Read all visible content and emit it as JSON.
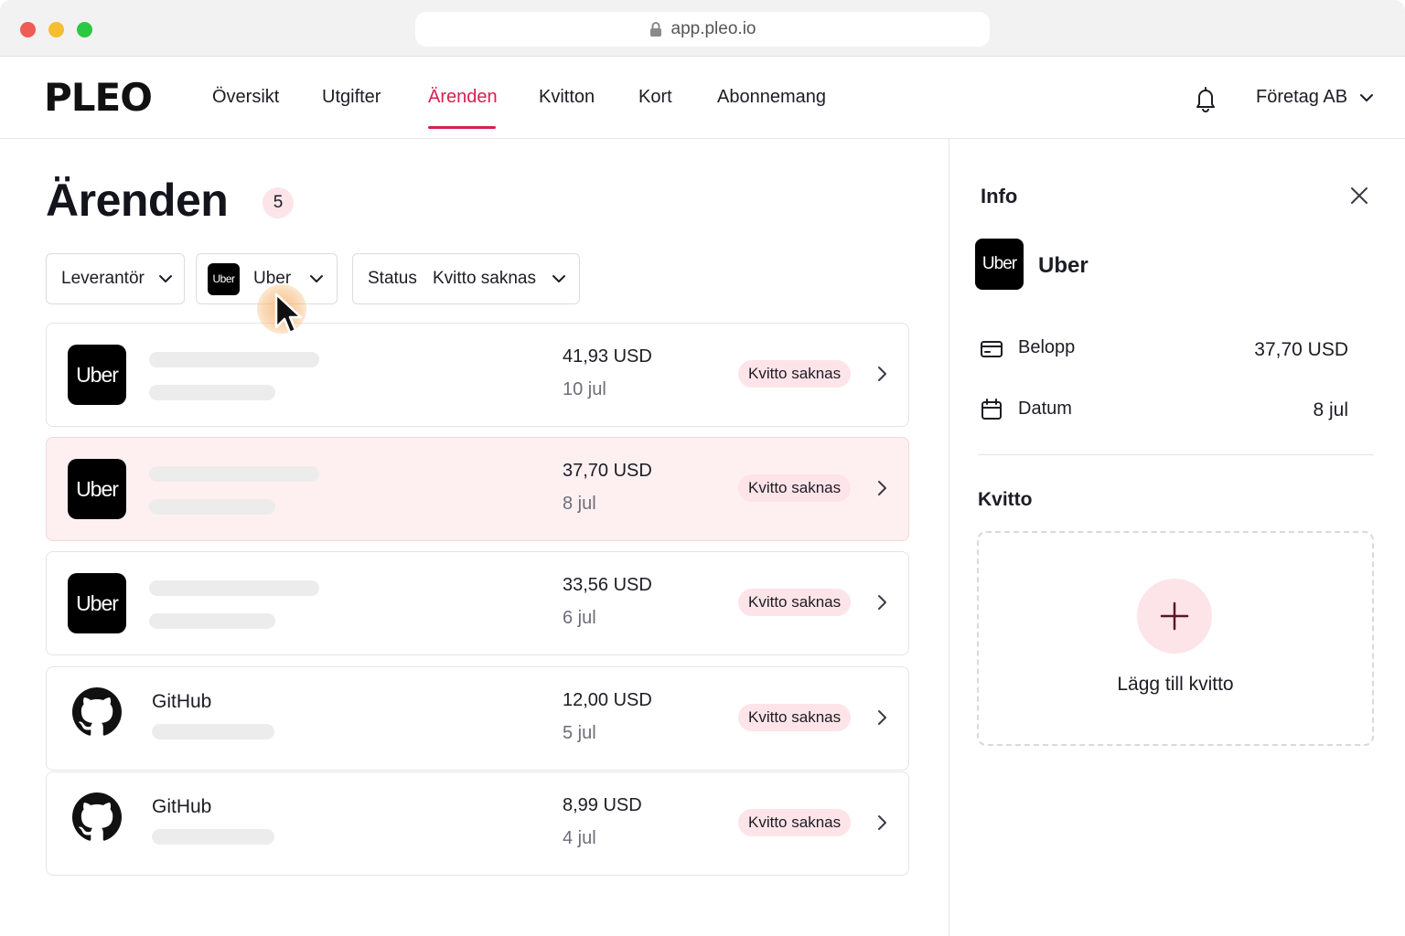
{
  "browser": {
    "url": "app.pleo.io"
  },
  "brand": {
    "logo": "PLEO",
    "accent": "#d6204f",
    "badge_bg": "#fde4e8"
  },
  "nav": {
    "items": [
      {
        "label": "Översikt"
      },
      {
        "label": "Utgifter"
      },
      {
        "label": "Ärenden"
      },
      {
        "label": "Kvitton"
      },
      {
        "label": "Kort"
      },
      {
        "label": "Abonnemang"
      }
    ],
    "active": "Ärenden",
    "company": "Företag AB"
  },
  "page": {
    "title": "Ärenden",
    "count": "5"
  },
  "filters": {
    "supplier_label": "Leverantör",
    "vendor_label": "Uber",
    "vendor_logo": "Uber",
    "status_label": "Status",
    "status_value": "Kvitto saknas"
  },
  "rows": [
    {
      "logo": "Uber",
      "vendor": "",
      "amount": "41,93 USD",
      "date": "10 jul",
      "status": "Kvitto saknas",
      "selected": false
    },
    {
      "logo": "Uber",
      "vendor": "",
      "amount": "37,70 USD",
      "date": "8 jul",
      "status": "Kvitto saknas",
      "selected": true
    },
    {
      "logo": "Uber",
      "vendor": "",
      "amount": "33,56 USD",
      "date": "6 jul",
      "status": "Kvitto saknas",
      "selected": false
    },
    {
      "logo": "github-icon",
      "vendor": "GitHub",
      "amount": "12,00 USD",
      "date": "5 jul",
      "status": "Kvitto saknas",
      "selected": false
    },
    {
      "logo": "github-icon",
      "vendor": "GitHub",
      "amount": "8,99 USD",
      "date": "4 jul",
      "status": "Kvitto saknas",
      "selected": false
    }
  ],
  "side": {
    "title": "Info",
    "vendor_logo": "Uber",
    "vendor": "Uber",
    "amount_label": "Belopp",
    "amount_value": "37,70 USD",
    "date_label": "Datum",
    "date_value": "8 jul",
    "receipt_title": "Kvitto",
    "add_receipt": "Lägg till kvitto"
  }
}
